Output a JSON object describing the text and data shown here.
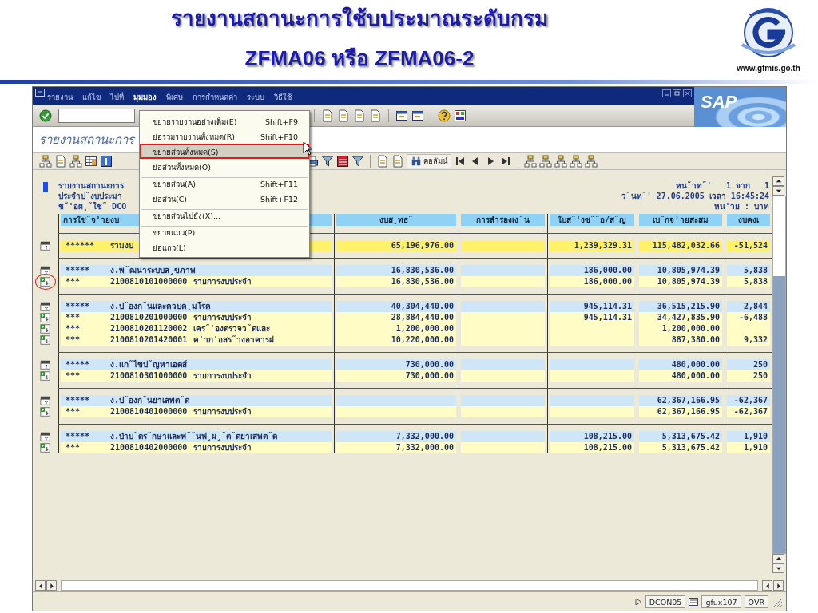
{
  "slide": {
    "title": "รายงานสถานะการใช้บประมาณระดับกรม",
    "subtitle": "ZFMA06 หรือ ZFMA06-2",
    "url": "www.gfmis.go.th"
  },
  "window": {
    "logo": "SAP",
    "menu": [
      {
        "label": "รายงาน",
        "selected": false
      },
      {
        "label": "แก้ไข",
        "selected": false
      },
      {
        "label": "ไปที่",
        "selected": false
      },
      {
        "label": "มุมมอง",
        "selected": true
      },
      {
        "label": "พิเศษ",
        "selected": false
      },
      {
        "label": "การกำหนดค่า",
        "selected": false
      },
      {
        "label": "ระบบ",
        "selected": false
      },
      {
        "label": "วิธีใช้",
        "selected": false
      }
    ],
    "menu_dropdown": [
      {
        "label": "ขยายรายงานอย่างเต็ม(E)",
        "shortcut": "Shift+F9",
        "selected": false,
        "separator_before": false
      },
      {
        "label": "ย่อรวมรายงานทั้งหมด(R)",
        "shortcut": "Shift+F10",
        "selected": false,
        "separator_before": false
      },
      {
        "label": "ขยายส่วนทั้งหมด(S)",
        "selected": true,
        "separator_before": false
      },
      {
        "label": "ย่อส่วนทั้งหมด(O)",
        "selected": false,
        "separator_before": false
      },
      {
        "label": "ขยายส่วน(A)",
        "shortcut": "Shift+F11",
        "selected": false,
        "separator_before": true
      },
      {
        "label": "ย่อส่วน(C)",
        "shortcut": "Shift+F12",
        "selected": false,
        "separator_before": false
      },
      {
        "label": "ขยายส่วนไปยัง(X)...",
        "selected": false,
        "separator_before": true
      },
      {
        "label": "ขยายแถว(P)",
        "selected": false,
        "separator_before": true
      },
      {
        "label": "ย่อแถว(L)",
        "selected": false,
        "separator_before": false
      }
    ],
    "screen_title": "รายงานสถานะการ",
    "app_toolbar": {
      "column_button": "คอลัมน์"
    },
    "report_header": {
      "left": [
        "รายงานสถานะการ",
        "ประจำป˜งบประมา",
        "ช˜'อผ¸˜ใช˜ DCO"
      ],
      "right": [
        "หน˜าท˜'   1 จาก   1",
        "ว˜นท˜' 27.06.2005 เวลา 16:45:24",
        "หน'วย : บาท"
      ]
    },
    "table": {
      "columns": [
        "การใช˜จ'ายงบ",
        "งบส¸ทธ˜",
        "การสำรองเง˜น",
        "ใบส˜'งซ˜˜อ/ส˜ญ",
        "เบ˜กจ'ายสะสม",
        "งบคงเ"
      ],
      "sections": [
        {
          "rows": [
            {
              "kind": "total",
              "stars": "******",
              "name": "รวมงบ",
              "circled": false,
              "values": {
                "budget": "65,196,976.00",
                "commitment": "1,239,329.31",
                "disbursed": "115,482,032.66",
                "balance": "-51,524"
              }
            }
          ]
        },
        {
          "rows": [
            {
              "kind": "group",
              "stars": "*****",
              "name": "ง.พ˜ฒนาระบบส¸ขภาพ",
              "circled": false,
              "values": {
                "budget": "16,830,536.00",
                "commitment": "186,000.00",
                "disbursed": "10,805,974.39",
                "balance": "5,838"
              }
            },
            {
              "kind": "item",
              "stars": "***",
              "code": "2100810101000000",
              "name": "รายการงบประจำ",
              "circled": true,
              "values": {
                "budget": "16,830,536.00",
                "commitment": "186,000.00",
                "disbursed": "10,805,974.39",
                "balance": "5,838"
              }
            }
          ]
        },
        {
          "rows": [
            {
              "kind": "group",
              "stars": "*****",
              "name": "ง.ป˜องก˜นและควบค¸มโรค",
              "circled": false,
              "values": {
                "budget": "40,304,440.00",
                "commitment": "945,114.31",
                "disbursed": "36,515,215.90",
                "balance": "2,844"
              }
            },
            {
              "kind": "item",
              "stars": "***",
              "code": "2100810201000000",
              "name": "รายการงบประจำ",
              "circled": false,
              "values": {
                "budget": "28,884,440.00",
                "commitment": "945,114.31",
                "disbursed": "34,427,835.90",
                "balance": "-6,488"
              }
            },
            {
              "kind": "item",
              "stars": "***",
              "code": "2100810201120002",
              "name": "เคร˜'องตรวจว˜ดและ",
              "circled": false,
              "values": {
                "budget": "1,200,000.00",
                "disbursed": "1,200,000.00"
              }
            },
            {
              "kind": "item",
              "stars": "***",
              "code": "2100810201420001",
              "name": "ค'าก'อสร˜างอาคารฝ",
              "circled": false,
              "values": {
                "budget": "10,220,000.00",
                "disbursed": "887,380.00",
                "balance": "9,332"
              }
            }
          ]
        },
        {
          "rows": [
            {
              "kind": "group",
              "stars": "*****",
              "name": "ง.แก˜ไขป˜ญหาเอดส์",
              "circled": false,
              "values": {
                "budget": "730,000.00",
                "disbursed": "480,000.00",
                "balance": "250"
              }
            },
            {
              "kind": "item",
              "stars": "***",
              "code": "2100810301000000",
              "name": "รายการงบประจำ",
              "circled": false,
              "values": {
                "budget": "730,000.00",
                "disbursed": "480,000.00",
                "balance": "250"
              }
            }
          ]
        },
        {
          "rows": [
            {
              "kind": "group",
              "stars": "*****",
              "name": "ง.ป˜องก˜นยาเสพต˜ด",
              "circled": false,
              "values": {
                "disbursed": "62,367,166.95",
                "balance": "-62,367"
              }
            },
            {
              "kind": "item",
              "stars": "***",
              "code": "2100810401000000",
              "name": "รายการงบประจำ",
              "circled": false,
              "values": {
                "disbursed": "62,367,166.95",
                "balance": "-62,367"
              }
            }
          ]
        },
        {
          "rows": [
            {
              "kind": "group",
              "stars": "*****",
              "name": "ง.บำบ˜ดร˜กษาและฟ˜˜นฟ¸ผ¸˜ต˜ดยาเสพต˜ด",
              "circled": false,
              "values": {
                "budget": "7,332,000.00",
                "commitment": "108,215.00",
                "disbursed": "5,313,675.42",
                "balance": "1,910"
              }
            },
            {
              "kind": "item",
              "stars": "***",
              "code": "2100810402000000",
              "name": "รายการงบประจำ",
              "circled": false,
              "values": {
                "budget": "7,332,000.00",
                "commitment": "108,215.00",
                "disbursed": "5,313,675.42",
                "balance": "1,910"
              }
            }
          ]
        }
      ]
    },
    "status_bar": {
      "session": "DCON05",
      "server": "gfux107",
      "mode": "OVR"
    }
  }
}
